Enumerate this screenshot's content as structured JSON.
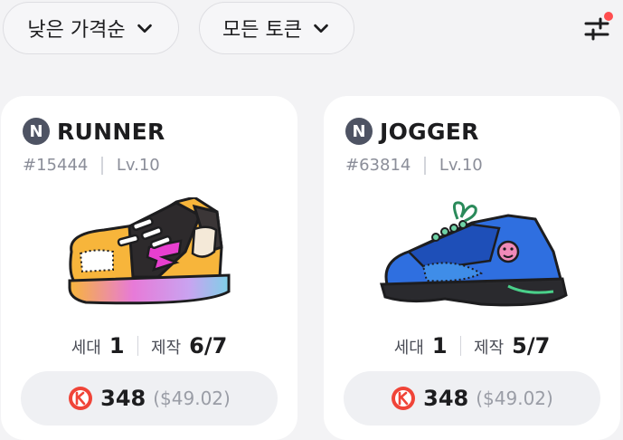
{
  "filters": {
    "sort_label": "낮은 가격순",
    "token_label": "모든 토큰"
  },
  "colors": {
    "badge_bg": "#4e5363",
    "coin": "#f04438",
    "filter_dot": "#ff4d4f"
  },
  "cards": [
    {
      "badge": "N",
      "name": "RUNNER",
      "id": "#15444",
      "level": "Lv.10",
      "gen_label": "세대",
      "gen_value": "1",
      "mint_label": "제작",
      "mint_value": "6/7",
      "price": "348",
      "price_usd": "($49.02)"
    },
    {
      "badge": "N",
      "name": "JOGGER",
      "id": "#63814",
      "level": "Lv.10",
      "gen_label": "세대",
      "gen_value": "1",
      "mint_label": "제작",
      "mint_value": "5/7",
      "price": "348",
      "price_usd": "($49.02)"
    }
  ]
}
